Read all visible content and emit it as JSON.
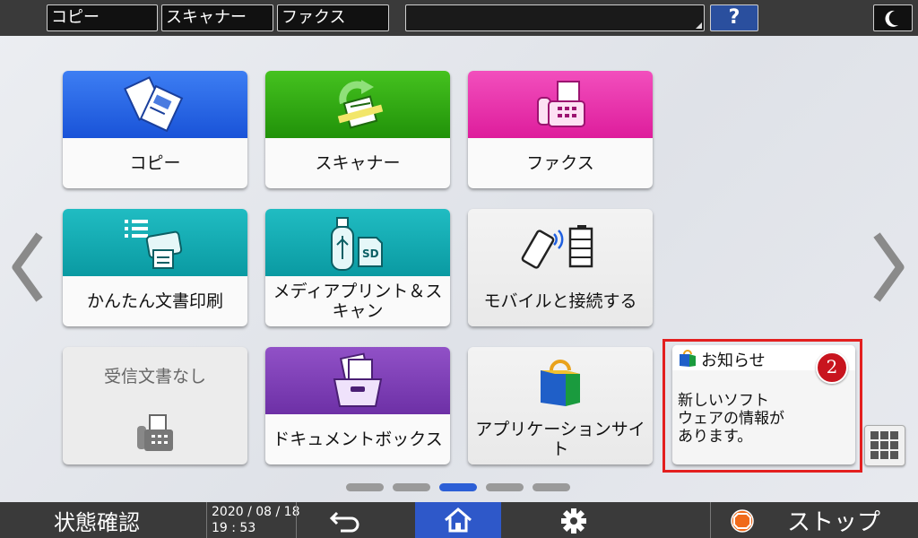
{
  "topbar": {
    "tabs": [
      "コピー",
      "スキャナー",
      "ファクス"
    ],
    "help_label": "?"
  },
  "tiles": [
    {
      "label": "コピー",
      "band_color": "#1f5fe0",
      "icon": "copy-icon"
    },
    {
      "label": "スキャナー",
      "band_color": "#2aa10f",
      "icon": "scanner-icon"
    },
    {
      "label": "ファクス",
      "band_color": "#e629a6",
      "icon": "fax-icon"
    },
    {
      "label": "かんたん文書印刷",
      "band_color": "#10a9b0",
      "icon": "printer-icon"
    },
    {
      "label": "メディアプリント＆スキャン",
      "band_color": "#10a9b0",
      "icon": "media-icon"
    },
    {
      "label": "モバイルと接続する",
      "icon": "mobile-connect-icon"
    },
    {
      "label": "受信文書なし",
      "icon": "fax-small-icon"
    },
    {
      "label": "ドキュメントボックス",
      "band_color": "#7a3fae",
      "icon": "document-box-icon"
    },
    {
      "label": "アプリケーションサイト",
      "icon": "shopping-bag-icon"
    }
  ],
  "notice": {
    "title": "お知らせ",
    "badge_count": "2",
    "message_lines": [
      "新しいソフト",
      "ウェアの情報が",
      "あります。"
    ]
  },
  "page_indicator": {
    "count": 5,
    "active_index": 2
  },
  "bottombar": {
    "status_label": "状態確認",
    "date": "2020 / 08 / 18",
    "time": "19 : 53",
    "stop_label": "ストップ"
  },
  "colors": {
    "accent": "#2e58c9",
    "highlight_frame": "#e31f1f",
    "badge": "#c8141e"
  }
}
